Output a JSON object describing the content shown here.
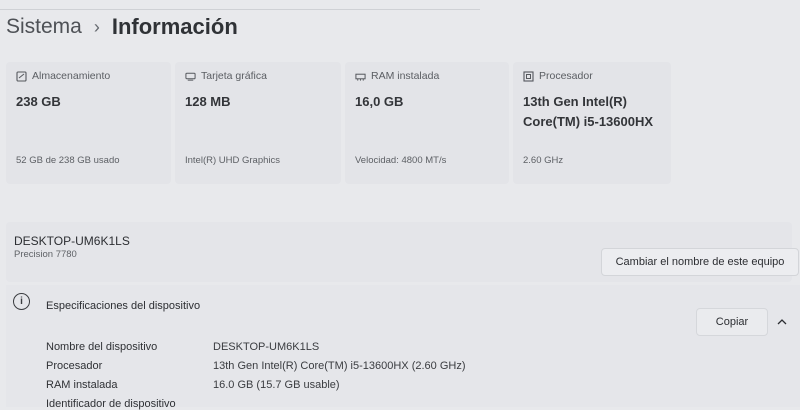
{
  "breadcrumb": {
    "parent": "Sistema",
    "separator": "›",
    "current": "Información"
  },
  "cards": [
    {
      "icon": "storage-icon",
      "title": "Almacenamiento",
      "value": "238 GB",
      "sub": "52 GB de 238 GB usado"
    },
    {
      "icon": "gpu-icon",
      "title": "Tarjeta gráfica",
      "value": "128 MB",
      "sub": "Intel(R) UHD Graphics"
    },
    {
      "icon": "ram-icon",
      "title": "RAM instalada",
      "value": "16,0 GB",
      "sub": "Velocidad: 4800 MT/s"
    },
    {
      "icon": "processor-icon",
      "title": "Procesador",
      "value_line1": "13th Gen Intel(R)",
      "value_line2": "Core(TM) i5-13600HX",
      "sub": "2.60 GHz"
    }
  ],
  "device": {
    "name": "DESKTOP-UM6K1LS",
    "model": "Precision 7780",
    "rename_label": "Cambiar el nombre de este equipo"
  },
  "specs": {
    "title": "Especificaciones del dispositivo",
    "copy_label": "Copiar",
    "rows": [
      {
        "label": "Nombre del dispositivo",
        "value": "DESKTOP-UM6K1LS"
      },
      {
        "label": "Procesador",
        "value": "13th Gen Intel(R) Core(TM) i5-13600HX (2.60 GHz)"
      },
      {
        "label": "RAM instalada",
        "value": "16.0 GB (15.7 GB usable)"
      },
      {
        "label": "Identificador de dispositivo",
        "value": ""
      }
    ]
  }
}
